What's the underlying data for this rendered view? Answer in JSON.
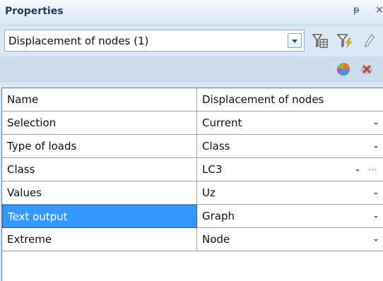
{
  "panel": {
    "title": "Properties",
    "pin_glyph": "ᵽ",
    "close_glyph": "×"
  },
  "selector": {
    "value": "Displacement of nodes (1)"
  },
  "toolbar": {
    "icons": [
      "filter-table-icon",
      "filter-flash-icon",
      "edit-pencil-icon"
    ]
  },
  "action_icons": [
    "pie-chart-icon",
    "remove-icon"
  ],
  "properties": [
    {
      "name": "Name",
      "value": "Displacement of nodes",
      "dropdown": false,
      "ellipsis": false
    },
    {
      "name": "Selection",
      "value": "Current",
      "dropdown": true,
      "ellipsis": false
    },
    {
      "name": "Type of loads",
      "value": "Class",
      "dropdown": true,
      "ellipsis": false
    },
    {
      "name": "Class",
      "value": "LC3",
      "dropdown": true,
      "ellipsis": true,
      "ellipsis_label": "..."
    },
    {
      "name": "Values",
      "value": "Uz",
      "dropdown": true,
      "ellipsis": false
    },
    {
      "name": "Text output",
      "value": "Graph",
      "dropdown": true,
      "ellipsis": false,
      "selected": true
    },
    {
      "name": "Extreme",
      "value": "Node",
      "dropdown": true,
      "ellipsis": false
    }
  ],
  "colors": {
    "selection": "#3399ff",
    "header": "#dce7f4",
    "panel_bg": "#cddcef"
  }
}
